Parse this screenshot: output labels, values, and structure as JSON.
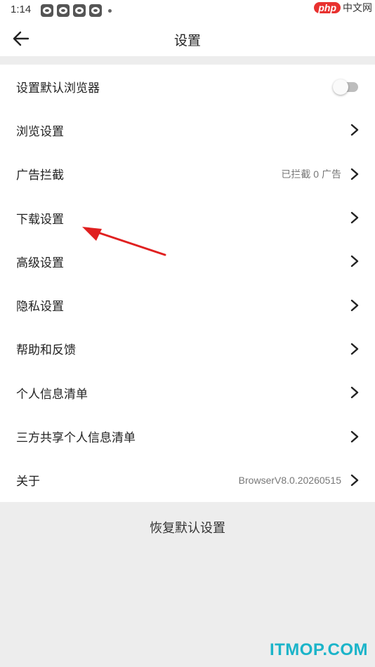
{
  "status_bar": {
    "time": "1:14",
    "notification_count": 4
  },
  "watermark_top": {
    "brand": "php",
    "text": "中文网"
  },
  "header": {
    "title": "设置"
  },
  "settings": [
    {
      "id": "default-browser",
      "label": "设置默认浏览器",
      "type": "toggle",
      "on": false
    },
    {
      "id": "browse",
      "label": "浏览设置",
      "type": "nav"
    },
    {
      "id": "ad-block",
      "label": "广告拦截",
      "type": "nav",
      "value": "已拦截 0 广告"
    },
    {
      "id": "download",
      "label": "下载设置",
      "type": "nav"
    },
    {
      "id": "advanced",
      "label": "高级设置",
      "type": "nav"
    },
    {
      "id": "privacy",
      "label": "隐私设置",
      "type": "nav"
    },
    {
      "id": "help",
      "label": "帮助和反馈",
      "type": "nav"
    },
    {
      "id": "personal-info",
      "label": "个人信息清单",
      "type": "nav"
    },
    {
      "id": "third-party",
      "label": "三方共享个人信息清单",
      "type": "nav"
    },
    {
      "id": "about",
      "label": "关于",
      "type": "nav",
      "value": "BrowserV8.0.20260515"
    }
  ],
  "reset_label": "恢复默认设置",
  "watermark_bottom": "ITMOP.COM",
  "colors": {
    "annotation_arrow": "#e02020",
    "watermark": "#1bb4c9"
  }
}
